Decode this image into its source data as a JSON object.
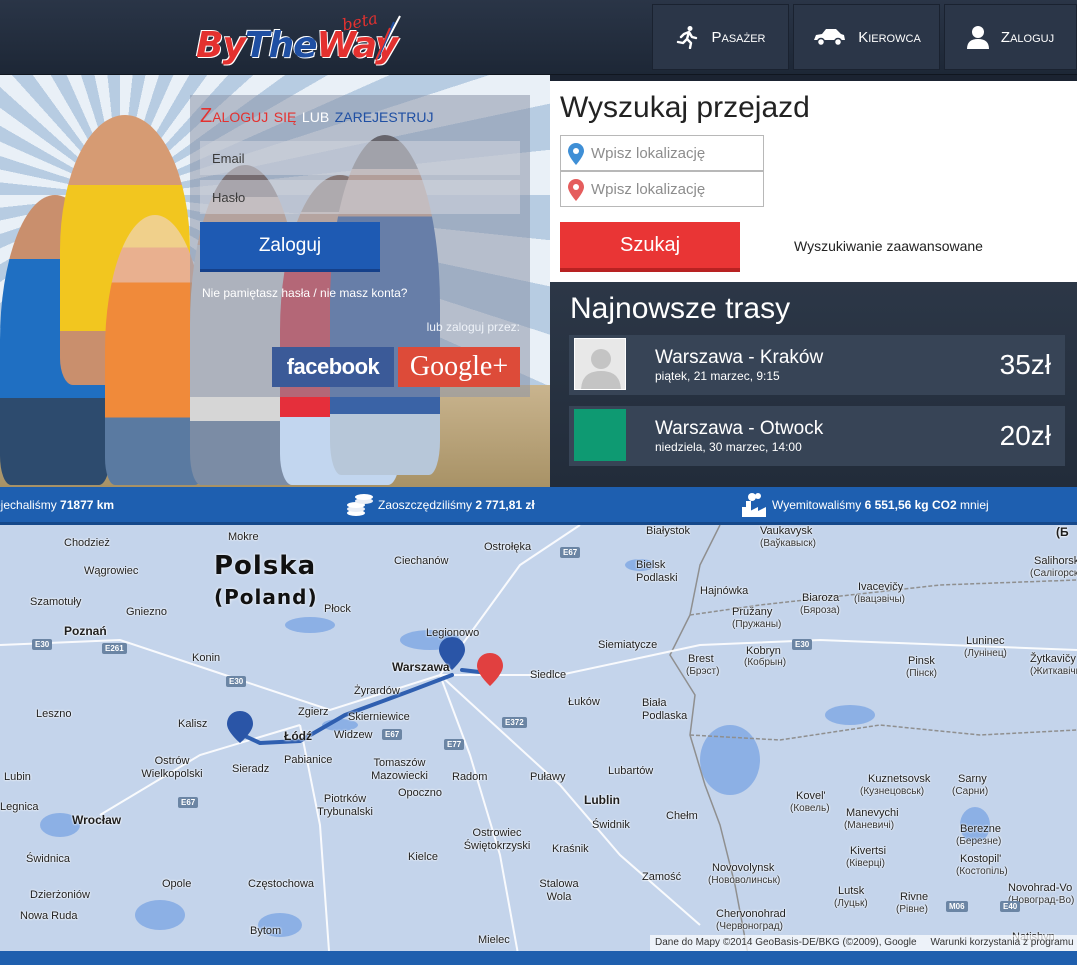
{
  "brand": {
    "logo_part1": "By",
    "logo_part2": "The",
    "logo_part3": "Way",
    "logo_beta": "beta"
  },
  "nav": {
    "pasazer": {
      "label": "Pasażer",
      "icon": "running-person-icon"
    },
    "kierowca": {
      "label": "Kierowca",
      "icon": "car-icon"
    },
    "zaloguj": {
      "label": "Zaloguj",
      "icon": "user-icon"
    }
  },
  "login": {
    "title_part1": "Zaloguj się",
    "title_part2": "lub",
    "title_part3": "zarejestruj",
    "email_placeholder": "Email",
    "password_placeholder": "Hasło",
    "submit_label": "Zaloguj",
    "forgot_text": "Nie pamiętasz hasła / nie masz konta?",
    "social_caption": "lub zaloguj przez:",
    "facebook_label": "facebook",
    "google_label": "Google+"
  },
  "search": {
    "title": "Wyszukaj przejazd",
    "from_placeholder": "Wpisz lokalizację",
    "to_placeholder": "Wpisz lokalizację",
    "submit_label": "Szukaj",
    "advanced_label": "Wyszukiwanie zaawansowane"
  },
  "routes": {
    "title": "Najnowsze trasy",
    "items": [
      {
        "name": "Warszawa - Kraków",
        "date": "piątek, 21 marzec, 9:15",
        "price": "35zł",
        "thumb": "avatar-placeholder"
      },
      {
        "name": "Warszawa - Otwock",
        "date": "niedziela, 30 marzec, 14:00",
        "price": "20zł",
        "thumb": "green-square"
      }
    ]
  },
  "stats": {
    "km_prefix": "ejechaliśmy",
    "km_value": "71877 km",
    "saved_prefix": "Zaoszczędziliśmy",
    "saved_value": "2 771,81 zł",
    "co2_prefix": "Wyemitowaliśmy",
    "co2_value": "6 551,56 kg CO2",
    "co2_suffix": "mniej"
  },
  "map": {
    "country": "Polska",
    "country_en": "(Poland)",
    "attribution": "Dane do Mapy ©2014 GeoBasis-DE/BKG (©2009), Google",
    "terms": "Warunki korzystania z programu",
    "roads": [
      "E67",
      "E30",
      "E261",
      "E30",
      "E67",
      "E77",
      "E372",
      "E30",
      "E67",
      "M06",
      "E40"
    ],
    "labels": [
      "Mokre",
      "Chodzież",
      "Wągrowiec",
      "Szamotuły",
      "Gniezno",
      "Poznań",
      "Konin",
      "Leszno",
      "Kalisz",
      "Ostrów Wielkopolski",
      "Sieradz",
      "Lubin",
      "Legnica",
      "Wrocław",
      "Świdnica",
      "Dzierżoniów",
      "Nowa Ruda",
      "Opole",
      "Częstochowa",
      "Bytom",
      "Ciechanów",
      "Ostrołęka",
      "Płock",
      "Legionowo",
      "Warszawa",
      "Żyrardów",
      "Zgierz",
      "Skierniewice",
      "Łódź",
      "Widzew",
      "Pabianice",
      "Tomaszów Mazowiecki",
      "Piotrków Trybunalski",
      "Opoczno",
      "Radom",
      "Puławy",
      "Lublin",
      "Siedlce",
      "Łuków",
      "Biała Podlaska",
      "Świdnik",
      "Lubartów",
      "Chełm",
      "Kraśnik",
      "Ostrowiec Świętokrzyski",
      "Kielce",
      "Stalowa Wola",
      "Zamość",
      "Mielec",
      "Białystok",
      "Bielsk Podlaski",
      "Hajnówka",
      "Siemiatycze",
      "Brest",
      "(Брэст)",
      "Kobryn",
      "(Кобрын)",
      "Pružany",
      "(Пружаны)",
      "Biaroza",
      "(Бяроза)",
      "Ivacevičy",
      "(Івацэвічы)",
      "Vaukavysk",
      "(Ваўкавыск)",
      "Pinsk",
      "(Пінск)",
      "Luninec",
      "(Лунінец)",
      "Žytkavičy",
      "(Житкавічы)",
      "Salihorsk",
      "(Салігорск)",
      "Kovel'",
      "(Ковель)",
      "Manevychi",
      "(Маневичі)",
      "Kuznetsovsk",
      "(Кузнецовськ)",
      "Sarny",
      "(Сарни)",
      "Kivertsi",
      "(Ківерці)",
      "Lutsk",
      "(Луцьк)",
      "Berezne",
      "(Березне)",
      "Kostopil'",
      "(Костопіль)",
      "Rivne",
      "(Рівне)",
      "Novovolynsk",
      "(Нововолинськ)",
      "Chervonohrad",
      "(Червоноград)",
      "Novohrad-Vo",
      "(Новоград-Во)",
      "Natishyn",
      "(Б"
    ]
  },
  "colors": {
    "brand_red": "#e4312f",
    "brand_blue": "#1f4fa3",
    "login_button": "#1e5ab3",
    "search_button": "#e93535",
    "stats_bar": "#1e5fb0",
    "route_line": "#2f5fb0"
  }
}
